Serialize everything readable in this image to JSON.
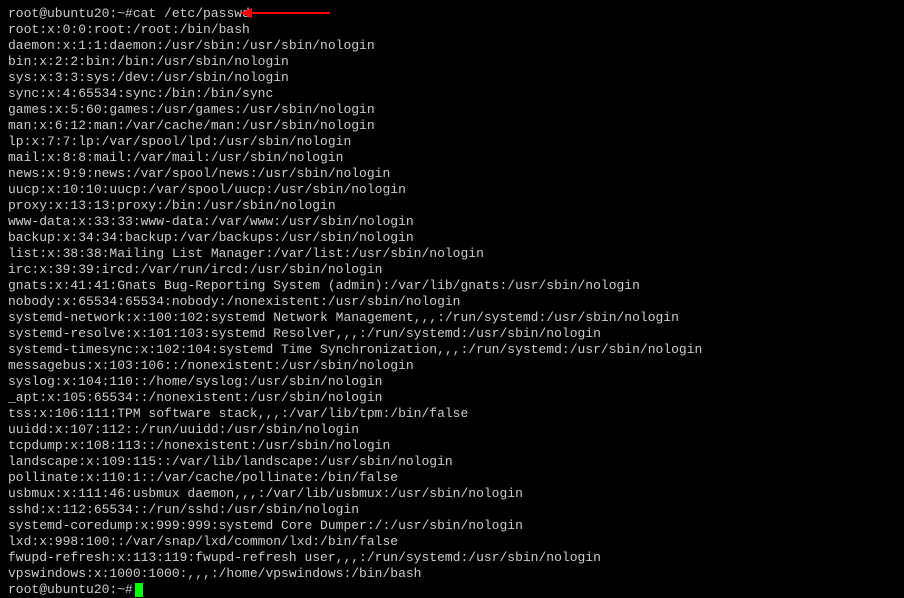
{
  "prompt1": "root@ubuntu20:~# ",
  "command": "cat /etc/passwd",
  "prompt2": "root@ubuntu20:~# ",
  "lines": [
    "root:x:0:0:root:/root:/bin/bash",
    "daemon:x:1:1:daemon:/usr/sbin:/usr/sbin/nologin",
    "bin:x:2:2:bin:/bin:/usr/sbin/nologin",
    "sys:x:3:3:sys:/dev:/usr/sbin/nologin",
    "sync:x:4:65534:sync:/bin:/bin/sync",
    "games:x:5:60:games:/usr/games:/usr/sbin/nologin",
    "man:x:6:12:man:/var/cache/man:/usr/sbin/nologin",
    "lp:x:7:7:lp:/var/spool/lpd:/usr/sbin/nologin",
    "mail:x:8:8:mail:/var/mail:/usr/sbin/nologin",
    "news:x:9:9:news:/var/spool/news:/usr/sbin/nologin",
    "uucp:x:10:10:uucp:/var/spool/uucp:/usr/sbin/nologin",
    "proxy:x:13:13:proxy:/bin:/usr/sbin/nologin",
    "www-data:x:33:33:www-data:/var/www:/usr/sbin/nologin",
    "backup:x:34:34:backup:/var/backups:/usr/sbin/nologin",
    "list:x:38:38:Mailing List Manager:/var/list:/usr/sbin/nologin",
    "irc:x:39:39:ircd:/var/run/ircd:/usr/sbin/nologin",
    "gnats:x:41:41:Gnats Bug-Reporting System (admin):/var/lib/gnats:/usr/sbin/nologin",
    "nobody:x:65534:65534:nobody:/nonexistent:/usr/sbin/nologin",
    "systemd-network:x:100:102:systemd Network Management,,,:/run/systemd:/usr/sbin/nologin",
    "systemd-resolve:x:101:103:systemd Resolver,,,:/run/systemd:/usr/sbin/nologin",
    "systemd-timesync:x:102:104:systemd Time Synchronization,,,:/run/systemd:/usr/sbin/nologin",
    "messagebus:x:103:106::/nonexistent:/usr/sbin/nologin",
    "syslog:x:104:110::/home/syslog:/usr/sbin/nologin",
    "_apt:x:105:65534::/nonexistent:/usr/sbin/nologin",
    "tss:x:106:111:TPM software stack,,,:/var/lib/tpm:/bin/false",
    "uuidd:x:107:112::/run/uuidd:/usr/sbin/nologin",
    "tcpdump:x:108:113::/nonexistent:/usr/sbin/nologin",
    "landscape:x:109:115::/var/lib/landscape:/usr/sbin/nologin",
    "pollinate:x:110:1::/var/cache/pollinate:/bin/false",
    "usbmux:x:111:46:usbmux daemon,,,:/var/lib/usbmux:/usr/sbin/nologin",
    "sshd:x:112:65534::/run/sshd:/usr/sbin/nologin",
    "systemd-coredump:x:999:999:systemd Core Dumper:/:/usr/sbin/nologin",
    "lxd:x:998:100::/var/snap/lxd/common/lxd:/bin/false",
    "fwupd-refresh:x:113:119:fwupd-refresh user,,,:/run/systemd:/usr/sbin/nologin",
    "vpswindows:x:1000:1000:,,,:/home/vpswindows:/bin/bash"
  ],
  "arrow_color": "#ff0000"
}
